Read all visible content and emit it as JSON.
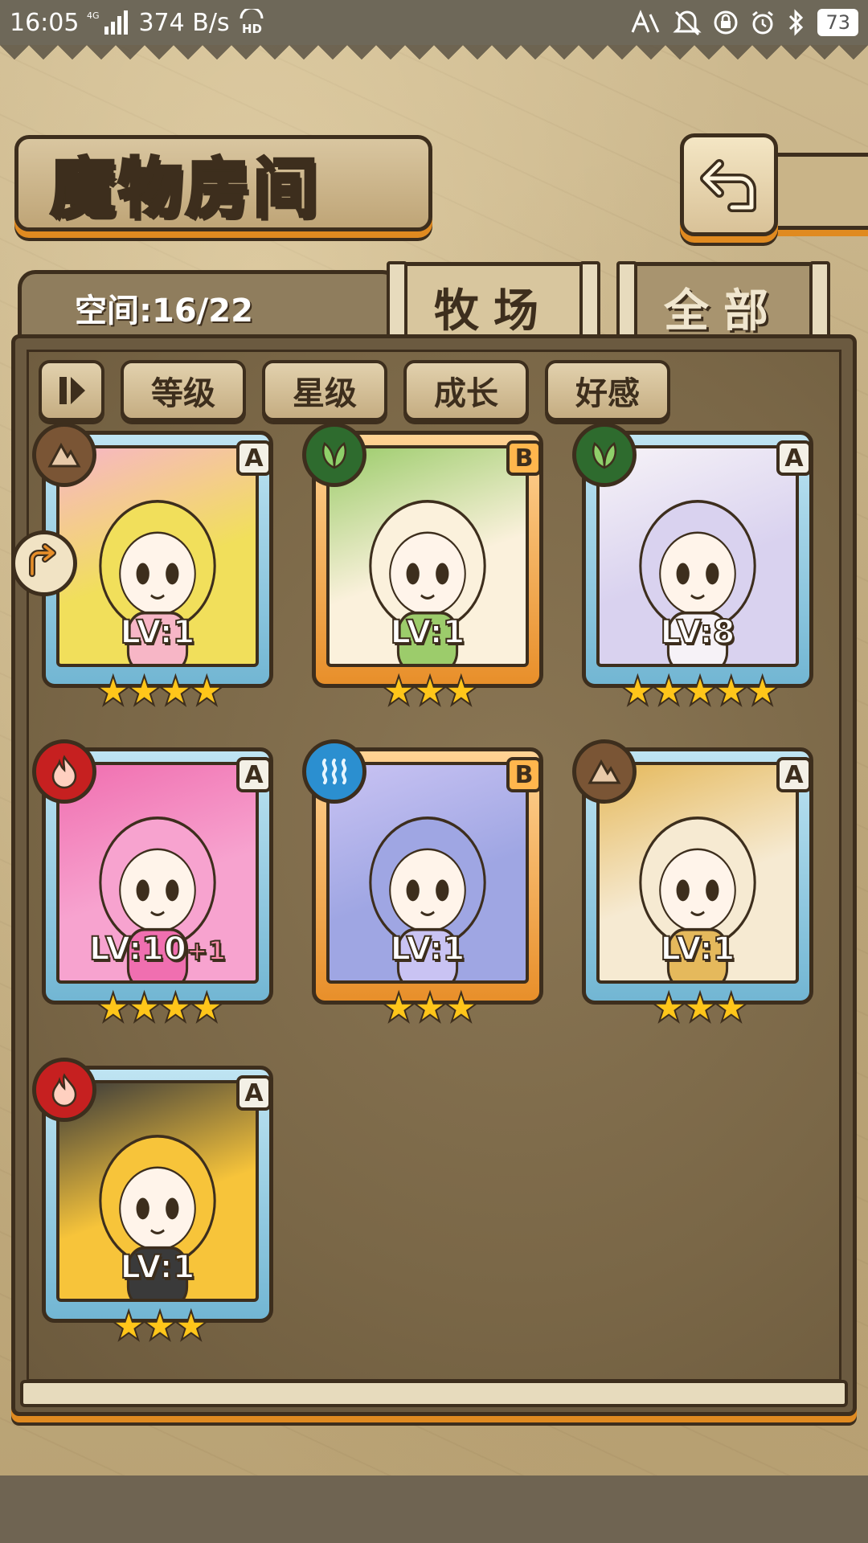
{
  "status_bar": {
    "time": "16:05",
    "network_type": "4G",
    "speed": "374 B/s",
    "hd_label": "HD",
    "battery": "73",
    "icons": [
      "signal-icon",
      "hd-icon",
      "nfc-icon",
      "mute-icon",
      "lock-icon",
      "alarm-icon",
      "bluetooth-icon",
      "battery-icon"
    ]
  },
  "header": {
    "title": "魔物房间",
    "back_icon": "back-arrow-icon"
  },
  "space": {
    "label": "空间:16/22"
  },
  "tabs": [
    {
      "label": "牧场",
      "active": true
    },
    {
      "label": "全部",
      "active": false
    }
  ],
  "filters": {
    "sort_icon": "sort-toggle-icon",
    "buttons": [
      "等级",
      "星级",
      "成长",
      "好感"
    ]
  },
  "monsters": [
    {
      "level": "LV:1",
      "bonus": "",
      "stars": "★★★★",
      "rank": "A",
      "element": "earth",
      "frame": "blue",
      "hair": "#f1df5b",
      "accent": "#f7b6c6"
    },
    {
      "level": "LV:1",
      "bonus": "",
      "stars": "★★★",
      "rank": "B",
      "element": "leaf",
      "frame": "orange",
      "hair": "#fbf1dc",
      "accent": "#9ccc6b"
    },
    {
      "level": "LV:8",
      "bonus": "",
      "stars": "★★★★★",
      "rank": "A",
      "element": "leaf",
      "frame": "blue",
      "hair": "#d9d2ef",
      "accent": "#f6f2f7"
    },
    {
      "level": "LV:10",
      "bonus": "+1",
      "stars": "★★★★",
      "rank": "A",
      "element": "fire",
      "frame": "blue",
      "hair": "#f7a3cf",
      "accent": "#f06fb0"
    },
    {
      "level": "LV:1",
      "bonus": "",
      "stars": "★★★",
      "rank": "B",
      "element": "water",
      "frame": "orange",
      "hair": "#9fa6e3",
      "accent": "#c9c3f3"
    },
    {
      "level": "LV:1",
      "bonus": "",
      "stars": "★★★",
      "rank": "A",
      "element": "earth",
      "frame": "blue",
      "hair": "#f6ead2",
      "accent": "#e5b95c"
    },
    {
      "level": "LV:1",
      "bonus": "",
      "stars": "★★★",
      "rank": "A",
      "element": "fire",
      "frame": "blue",
      "hair": "#f7c43a",
      "accent": "#3a3a3a"
    }
  ],
  "side_tab_icon": "collapse-arrow-icon",
  "colors": {
    "frame_blue": "#72b6d3",
    "frame_orange": "#e88f2a",
    "outline": "#3d2e1d",
    "star": "#ffc61a",
    "element_earth": "#7a5535",
    "element_leaf": "#2e6b2e",
    "element_fire": "#c62020",
    "element_water": "#2b8fd0"
  }
}
